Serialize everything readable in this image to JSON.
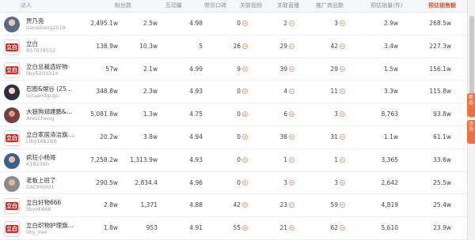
{
  "headers": {
    "creator": "达人",
    "fans": "粉丝数",
    "interactions": "互动量",
    "rating": "带货口碑",
    "videos": "关联视频",
    "lives": "关联直播",
    "products": "推广商品数",
    "est_sales": "预估销量(件)",
    "est_revenue": "预估销售额"
  },
  "rows": [
    {
      "name": "贾乃亮",
      "uid": "jianailiang2019",
      "avatar": "photo",
      "fans": "2,495.1w",
      "interactions": "2.5w",
      "rating": "4.98",
      "videos": "0",
      "lives": "2",
      "products": "3",
      "est_sales": "2.9w",
      "est_revenue": "268.5w"
    },
    {
      "name": "立白",
      "uid": "857078552",
      "avatar": "logo",
      "logo_text": "立白",
      "fans": "138.9w",
      "interactions": "10.3w",
      "rating": "5",
      "videos": "26",
      "lives": "29",
      "products": "42",
      "est_sales": "3.4w",
      "est_revenue": "227.3w"
    },
    {
      "name": "立白总裁选好物",
      "uid": "liby5201314",
      "avatar": "logo",
      "logo_text": "立白",
      "fans": "57w",
      "interactions": "2.1w",
      "rating": "4.99",
      "videos": "9",
      "lives": "39",
      "products": "29",
      "est_sales": "1.5w",
      "est_revenue": "156.1w"
    },
    {
      "name": "巴图&嫦谷 (25...",
      "uid": "tutuandgugu",
      "avatar": "photo2",
      "fans": "348.8w",
      "interactions": "2.3w",
      "rating": "4.93",
      "videos": "0",
      "lives": "4",
      "products": "11",
      "est_sales": "3.3w",
      "est_revenue": "115.8w"
    },
    {
      "name": "大狼狗郑建鹏&...",
      "uid": "AresCheng",
      "avatar": "photo3",
      "fans": "5,081.8w",
      "interactions": "1.3w",
      "rating": "4.75",
      "videos": "0",
      "lives": "6",
      "products": "3",
      "est_sales": "8,763",
      "est_revenue": "93.8w"
    },
    {
      "name": "立白家居清洁旗...",
      "uid": "Liby168168",
      "avatar": "logo",
      "logo_text": "立白",
      "fans": "20.2w",
      "interactions": "3.8w",
      "rating": "4.94",
      "videos": "0",
      "lives": "38",
      "products": "31",
      "est_sales": "1.1w",
      "est_revenue": "61.1w"
    },
    {
      "name": "疯狂小杨哥",
      "uid": "6182390",
      "avatar": "photo4",
      "fans": "7,258.2w",
      "interactions": "1,313.9w",
      "rating": "4.93",
      "videos": "0",
      "lives": "1",
      "products": "1",
      "est_sales": "3,365",
      "est_revenue": "33.6w"
    },
    {
      "name": "老板上班了",
      "uid": "DXCM0001",
      "avatar": "photo5",
      "fans": "290.5w",
      "interactions": "2,834.4",
      "rating": "4.96",
      "videos": "0",
      "lives": "3",
      "products": "3",
      "est_sales": "2,642",
      "est_revenue": "25.5w"
    },
    {
      "name": "立白好物666",
      "uid": "libyok666",
      "avatar": "logo",
      "logo_text": "立白",
      "fans": "2.8w",
      "interactions": "1,371",
      "rating": "4.88",
      "videos": "42",
      "lives": "23",
      "products": "59",
      "est_sales": "4,819",
      "est_revenue": "25.4w"
    },
    {
      "name": "立白织物护理旗...",
      "uid": "liby_live",
      "avatar": "logo",
      "logo_text": "立白",
      "fans": "1.8w",
      "interactions": "953",
      "rating": "4.91",
      "videos": "55",
      "lives": "21",
      "products": "62",
      "est_sales": "5,610",
      "est_revenue": "23.9w"
    }
  ],
  "side_tabs": [
    {
      "label": "新品"
    },
    {
      "label": "咨询"
    }
  ]
}
